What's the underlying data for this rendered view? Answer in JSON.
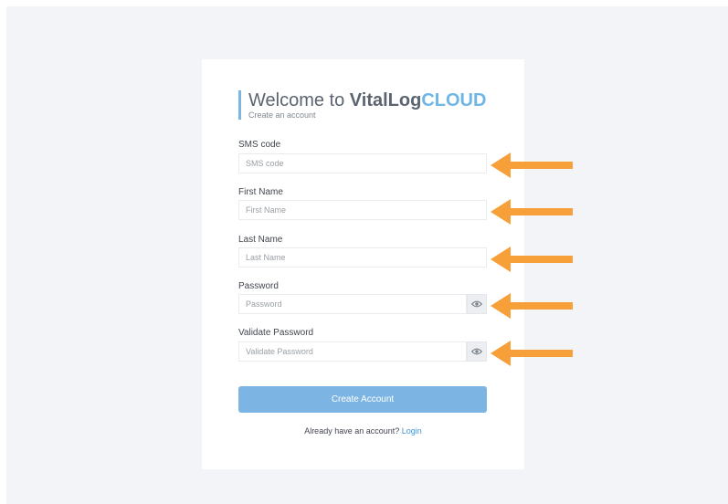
{
  "header": {
    "title_prefix": "Welcome to ",
    "brand_main": "VitalLog",
    "brand_accent": "CLOUD",
    "subtitle": "Create an account"
  },
  "form": {
    "sms_code": {
      "label": "SMS code",
      "placeholder": "SMS code",
      "value": ""
    },
    "first_name": {
      "label": "First Name",
      "placeholder": "First Name",
      "value": ""
    },
    "last_name": {
      "label": "Last Name",
      "placeholder": "Last Name",
      "value": ""
    },
    "password": {
      "label": "Password",
      "placeholder": "Password",
      "value": "",
      "toggle_icon": "eye-icon"
    },
    "validate_password": {
      "label": "Validate Password",
      "placeholder": "Validate Password",
      "value": "",
      "toggle_icon": "eye-icon"
    },
    "submit_label": "Create Account"
  },
  "footer": {
    "text": "Already have an account?",
    "link": "Login"
  },
  "colors": {
    "brand_accent": "#6fb6e6",
    "button": "#7cb5e3",
    "link": "#3f95d8",
    "arrow": "#f7a03a",
    "background": "#f3f4f7"
  },
  "annotations": {
    "arrow_count": 5,
    "arrow_icon": "arrow-left-icon"
  }
}
